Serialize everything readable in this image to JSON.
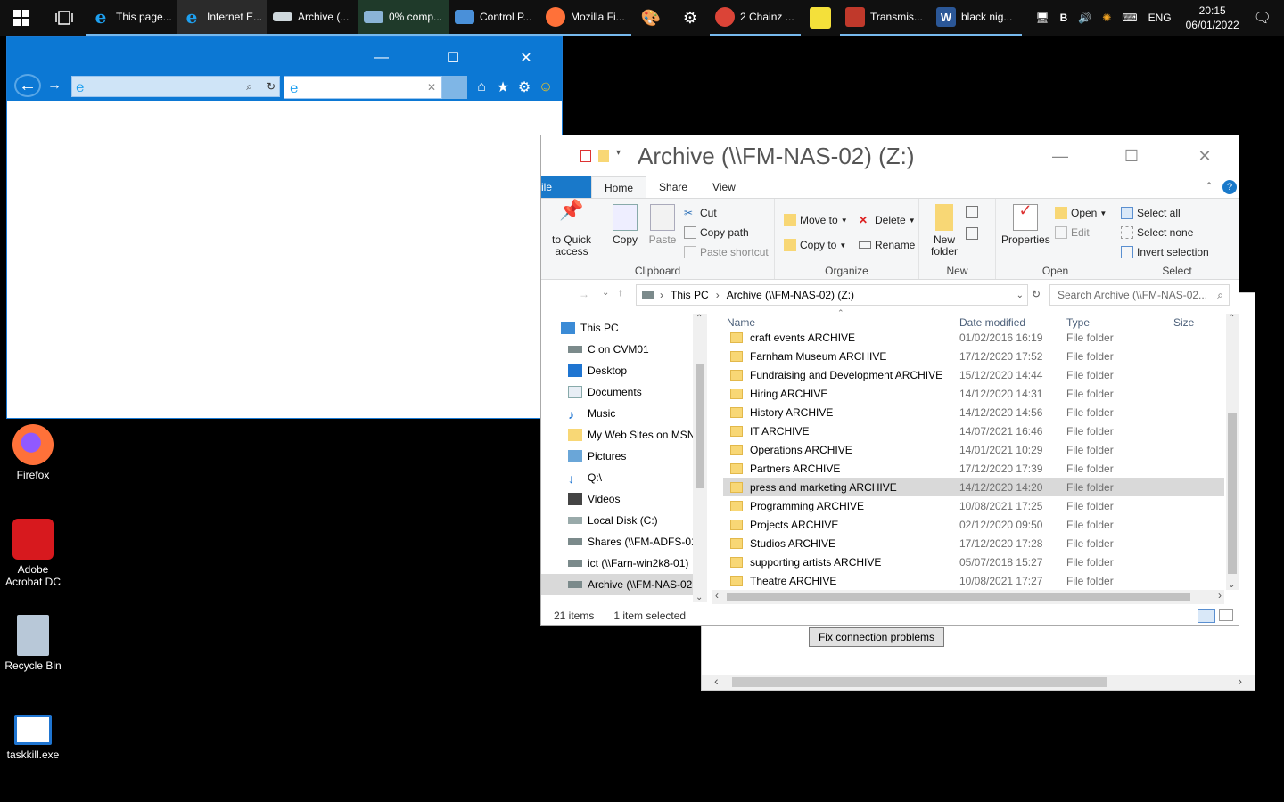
{
  "taskbar": {
    "items": [
      {
        "label": "This page...",
        "icon": "ie-icon",
        "color": "#1ea0f0"
      },
      {
        "label": "Internet E...",
        "icon": "ie-icon",
        "color": "#1ea0f0"
      },
      {
        "label": "Archive (...",
        "icon": "network-drive-icon",
        "color": "#cfd8dc"
      },
      {
        "label": "0% comp...",
        "icon": "copy-progress-icon",
        "color": "#8ab4d6"
      },
      {
        "label": "Control P...",
        "icon": "control-panel-icon",
        "color": "#4a90d9"
      },
      {
        "label": "Mozilla Fi...",
        "icon": "firefox-icon",
        "color": "#ff7139"
      },
      {
        "label": "2 Chainz ...",
        "icon": "chrome-icon",
        "color": "#db4437"
      },
      {
        "label": "Transmis...",
        "icon": "transmission-icon",
        "color": "#c0392b"
      },
      {
        "label": "black nig...",
        "icon": "word-icon",
        "color": "#2b5797"
      }
    ],
    "tray": {
      "lang": "ENG",
      "b_label": "B",
      "time": "20:15",
      "date": "06/01/2022"
    }
  },
  "desktop": {
    "icons": [
      {
        "label": "Firefox"
      },
      {
        "label": "Adobe Acrobat DC"
      },
      {
        "label": "Recycle Bin"
      },
      {
        "label": "taskkill.exe"
      }
    ]
  },
  "back_dialog": {
    "fix_button": "Fix connection problems"
  },
  "explorer": {
    "title": "Archive (\\\\FM-NAS-02) (Z:)",
    "tabs": {
      "file": "ile",
      "home": "Home",
      "share": "Share",
      "view": "View"
    },
    "ribbon": {
      "pin": "to Quick access",
      "copy": "Copy",
      "paste": "Paste",
      "cut": "Cut",
      "copy_path": "Copy path",
      "paste_shortcut": "Paste shortcut",
      "clipboard": "Clipboard",
      "move_to": "Move to",
      "copy_to": "Copy to",
      "delete": "Delete",
      "rename": "Rename",
      "organize": "Organize",
      "new_folder": "New folder",
      "new": "New",
      "properties": "Properties",
      "open": "Open",
      "edit": "Edit",
      "open_group": "Open",
      "select_all": "Select all",
      "select_none": "Select none",
      "invert_selection": "Invert selection",
      "select_group": "Select"
    },
    "address": {
      "this_pc": "This PC",
      "current": "Archive (\\\\FM-NAS-02) (Z:)",
      "search_placeholder": "Search Archive (\\\\FM-NAS-02..."
    },
    "nav": [
      {
        "label": "This PC"
      },
      {
        "label": "C on CVM01"
      },
      {
        "label": "Desktop"
      },
      {
        "label": "Documents"
      },
      {
        "label": "Music"
      },
      {
        "label": "My Web Sites on MSN"
      },
      {
        "label": "Pictures"
      },
      {
        "label": "Q:\\"
      },
      {
        "label": "Videos"
      },
      {
        "label": "Local Disk (C:)"
      },
      {
        "label": "Shares (\\\\FM-ADFS-01"
      },
      {
        "label": "ict (\\\\Farn-win2k8-01)"
      },
      {
        "label": "Archive (\\\\FM-NAS-02"
      }
    ],
    "columns": {
      "name": "Name",
      "date": "Date modified",
      "type": "Type",
      "size": "Size"
    },
    "files": [
      {
        "name": "craft events ARCHIVE",
        "date": "01/02/2016 16:19",
        "type": "File folder"
      },
      {
        "name": "Farnham Museum ARCHIVE",
        "date": "17/12/2020 17:52",
        "type": "File folder"
      },
      {
        "name": "Fundraising and Development ARCHIVE",
        "date": "15/12/2020 14:44",
        "type": "File folder"
      },
      {
        "name": "Hiring ARCHIVE",
        "date": "14/12/2020 14:31",
        "type": "File folder"
      },
      {
        "name": "History ARCHIVE",
        "date": "14/12/2020 14:56",
        "type": "File folder"
      },
      {
        "name": "IT ARCHIVE",
        "date": "14/07/2021 16:46",
        "type": "File folder"
      },
      {
        "name": "Operations ARCHIVE",
        "date": "14/01/2021 10:29",
        "type": "File folder"
      },
      {
        "name": "Partners ARCHIVE",
        "date": "17/12/2020 17:39",
        "type": "File folder"
      },
      {
        "name": "press and marketing ARCHIVE",
        "date": "14/12/2020 14:20",
        "type": "File folder"
      },
      {
        "name": "Programming ARCHIVE",
        "date": "10/08/2021 17:25",
        "type": "File folder"
      },
      {
        "name": "Projects ARCHIVE",
        "date": "02/12/2020 09:50",
        "type": "File folder"
      },
      {
        "name": "Studios ARCHIVE",
        "date": "17/12/2020 17:28",
        "type": "File folder"
      },
      {
        "name": "supporting artists ARCHIVE",
        "date": "05/07/2018 15:27",
        "type": "File folder"
      },
      {
        "name": "Theatre ARCHIVE",
        "date": "10/08/2021 17:27",
        "type": "File folder"
      }
    ],
    "status": {
      "count": "21 items",
      "selected": "1 item selected"
    }
  }
}
